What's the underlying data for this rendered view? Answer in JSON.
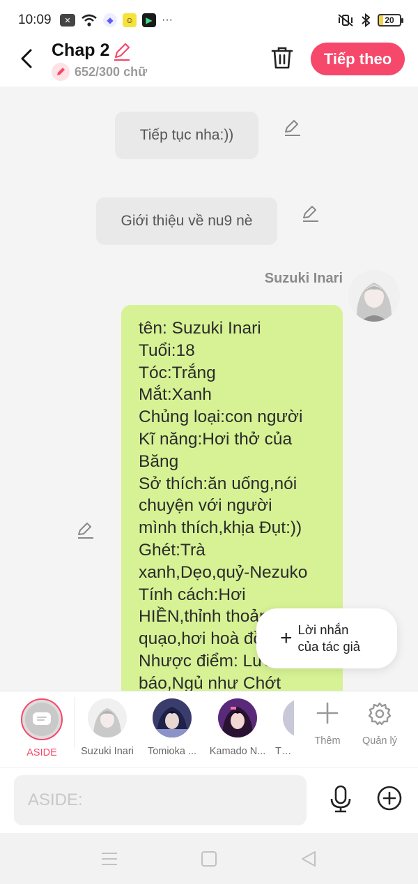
{
  "status_bar": {
    "time": "10:09",
    "more": "···",
    "battery_level": "20",
    "icons": [
      "close-box-icon",
      "wifi-icon",
      "messenger-icon",
      "emoji-app-icon",
      "game-app-icon",
      "mute-vibrate-icon",
      "bluetooth-icon",
      "battery-icon"
    ]
  },
  "header": {
    "title": "Chap 2",
    "word_count": "652/300 chữ",
    "next_button": "Tiếp theo"
  },
  "chat": {
    "aside_messages": [
      "Tiếp tục nha:))",
      "Giới thiệu về nu9 nè"
    ],
    "character_name": "Suzuki Inari",
    "message_lines": [
      "tên: Suzuki Inari",
      "Tuổi:18",
      "Tóc:Trắng",
      "Mắt:Xanh",
      "Chủng loại:con người",
      "Kĩ năng:Hơi thở của",
      "Băng",
      "Sở thích:ăn uống,nói",
      "chuyện với người",
      "mình thích,khịa Đụt:))",
      "Ghét:Trà",
      "xanh,Dẹo,quỷ-Nezuko",
      "Tính cách:Hơi",
      "HIỀN,thỉnh thoảng",
      "quạo,hơi hoà đồng",
      "Nhược điểm: Lười,",
      "báo,Ngủ như Chớt"
    ],
    "author_note": {
      "line1": "Lời nhắn",
      "line2": "của tác giả"
    }
  },
  "character_bar": {
    "items": [
      {
        "label": "ASIDE",
        "selected": true
      },
      {
        "label": "Suzuki Inari"
      },
      {
        "label": "Tomioka ..."
      },
      {
        "label": "Kamado N..."
      },
      {
        "label": "Tg u"
      }
    ],
    "add_label": "Thêm",
    "manage_label": "Quản lý"
  },
  "input": {
    "placeholder": "ASIDE:"
  },
  "colors": {
    "accent": "#f6486b",
    "bubble_green": "#d6f294",
    "aside_gray": "#e9e9e9"
  }
}
